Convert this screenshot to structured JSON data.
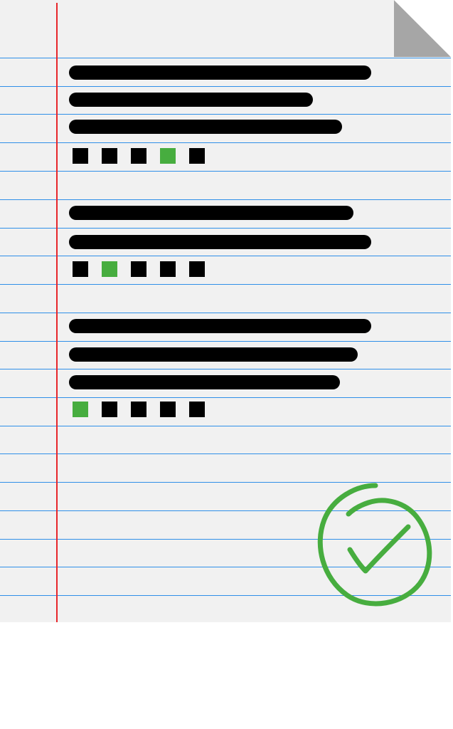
{
  "colors": {
    "paper": "#f1f1f1",
    "rule_line": "#2f8fe8",
    "margin_line": "#e8262a",
    "text_bar": "#000000",
    "box_default": "#000000",
    "box_selected": "#47ad3f",
    "check_mark": "#47ad3f",
    "fold": "#a6a6a6"
  },
  "questions": [
    {
      "text_lines": 3,
      "options": 5,
      "selected_option": 4
    },
    {
      "text_lines": 2,
      "options": 5,
      "selected_option": 2
    },
    {
      "text_lines": 3,
      "options": 5,
      "selected_option": 1
    }
  ],
  "status_icon": "check-circle-icon"
}
